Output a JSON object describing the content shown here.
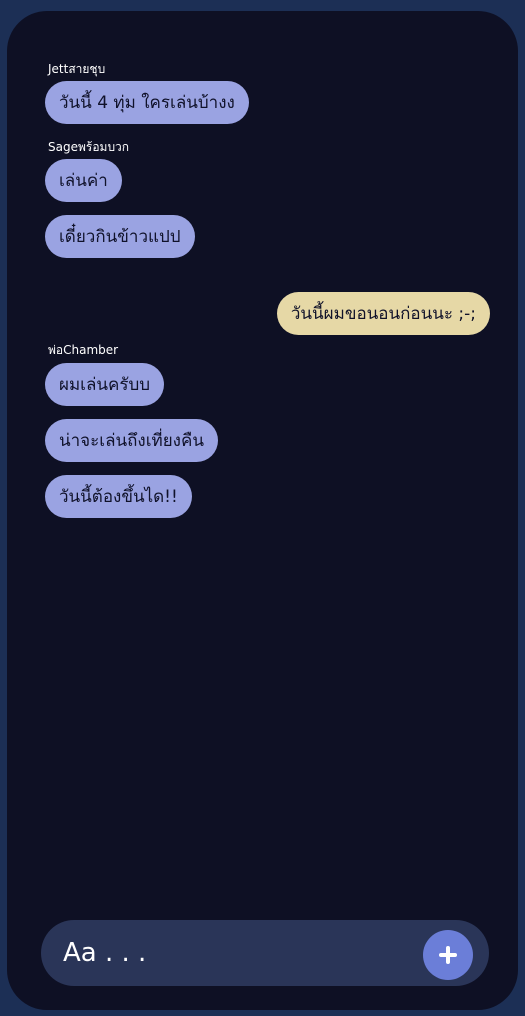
{
  "chat": {
    "messages": [
      {
        "sender": "Jettสายชุบ",
        "text": "วันนี้ 4 ทุ่ม ใครเล่นบ้างง",
        "direction": "incoming"
      },
      {
        "sender": "Sageพร้อมบวก",
        "text": "เล่นค่า",
        "direction": "incoming"
      },
      {
        "sender": "",
        "text": "เดี๋ยวกินข้าวแปป",
        "direction": "incoming"
      },
      {
        "sender": "",
        "text": "วันนี้ผมขอนอนก่อนนะ ;-;",
        "direction": "outgoing"
      },
      {
        "sender": "พ่อChamber",
        "text": "ผมเล่นครับบ",
        "direction": "incoming"
      },
      {
        "sender": "",
        "text": "น่าจะเล่นถึงเที่ยงคืน",
        "direction": "incoming"
      },
      {
        "sender": "",
        "text": "วันนี้ต้องขึ้นได!!",
        "direction": "incoming"
      }
    ]
  },
  "composer": {
    "placeholder": "Aa . . .",
    "add_icon": "plus-icon"
  },
  "colors": {
    "background": "#1c2f55",
    "chat_panel": "#0e1024",
    "incoming_bubble": "#9aa3e2",
    "outgoing_bubble": "#e6d8a6",
    "composer_bar": "#2a3558",
    "add_button": "#6b7ed8"
  }
}
